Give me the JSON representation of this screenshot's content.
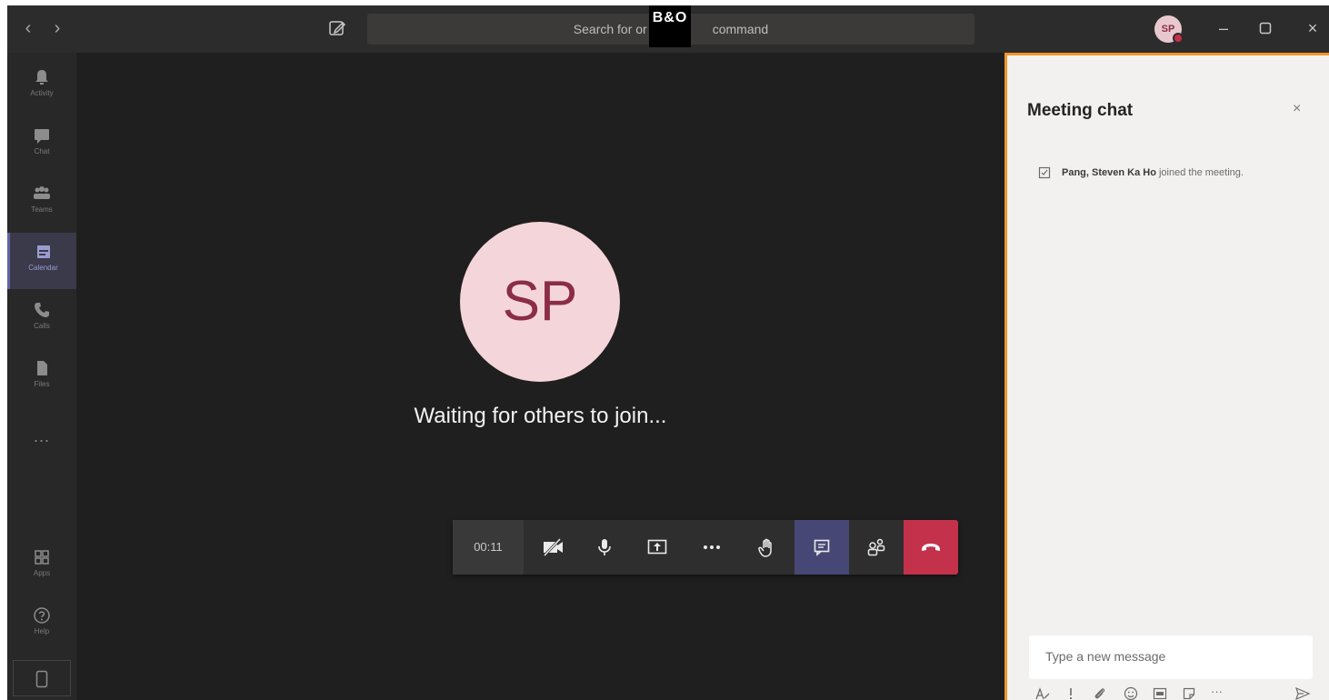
{
  "titlebar": {
    "search_placeholder_left": "Search for or",
    "search_placeholder_right": "command",
    "logo_text": "B&O",
    "user_initials": "SP"
  },
  "rail": {
    "items": [
      {
        "label": "Activity",
        "icon": "bell-icon"
      },
      {
        "label": "Chat",
        "icon": "chat-icon"
      },
      {
        "label": "Teams",
        "icon": "teams-icon"
      },
      {
        "label": "Calendar",
        "icon": "calendar-icon"
      },
      {
        "label": "Calls",
        "icon": "phone-icon"
      },
      {
        "label": "Files",
        "icon": "file-icon"
      }
    ],
    "more": "...",
    "bottom_items": [
      {
        "label": "Apps",
        "icon": "apps-icon"
      },
      {
        "label": "Help",
        "icon": "help-icon"
      }
    ]
  },
  "stage": {
    "avatar_initials": "SP",
    "waiting_text": "Waiting for others to join..."
  },
  "controls": {
    "timer": "00:11"
  },
  "chat": {
    "title": "Meeting chat",
    "close_glyph": "×",
    "system_message": {
      "name": "Pang, Steven Ka Ho",
      "text": "joined the meeting."
    },
    "compose_placeholder": "Type a new message",
    "more_glyph": "···"
  },
  "colors": {
    "accent": "#6264a7",
    "hangup": "#c4314b",
    "highlight_border": "#f2962b",
    "avatar_bg": "#f4d6da",
    "avatar_text": "#8b2d47"
  }
}
